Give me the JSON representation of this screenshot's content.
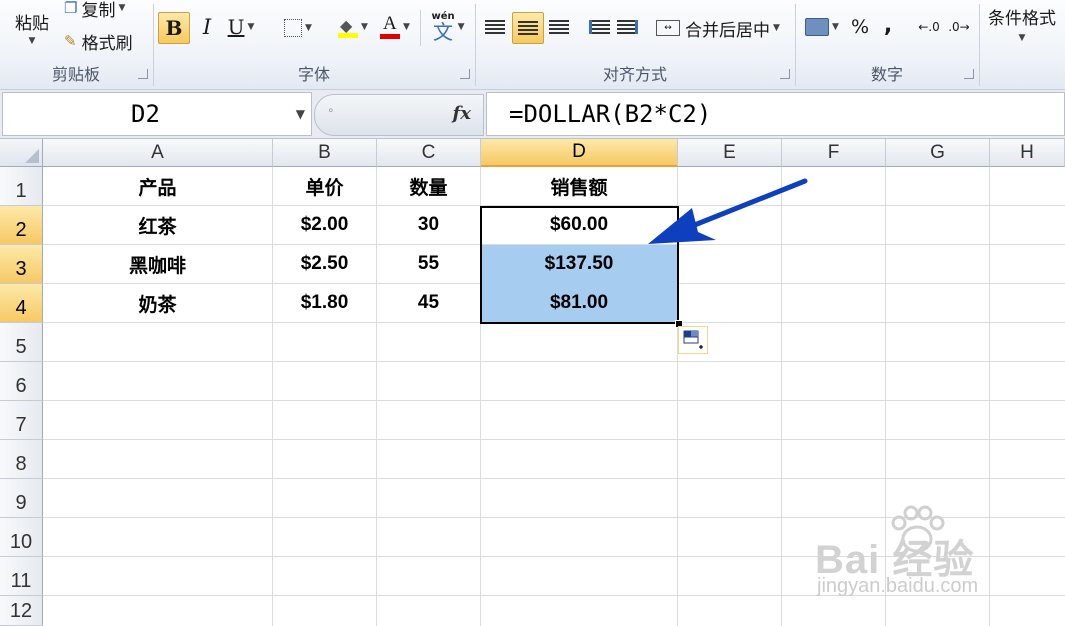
{
  "ribbon": {
    "clipboard": {
      "paste": "粘贴",
      "copy": "复制",
      "format_painter": "格式刷",
      "label": "剪贴板"
    },
    "font": {
      "bold": "B",
      "italic": "I",
      "underline": "U",
      "font_color_glyph": "A",
      "phonetic_top": "wén",
      "phonetic_bottom": "文",
      "label": "字体"
    },
    "alignment": {
      "merge_center": "合并后居中",
      "label": "对齐方式"
    },
    "number": {
      "percent": "%",
      "comma": ",",
      "label": "数字"
    },
    "styles": {
      "conditional_format": "条件格式"
    }
  },
  "formula_bar": {
    "name_box": "D2",
    "formula": "=DOLLAR(B2*C2)",
    "fx": "fx"
  },
  "grid": {
    "columns": [
      "A",
      "B",
      "C",
      "D",
      "E",
      "F",
      "G",
      "H"
    ],
    "rows": [
      "1",
      "2",
      "3",
      "4",
      "5",
      "6",
      "7",
      "8",
      "9",
      "10",
      "11",
      "12"
    ],
    "header_row": [
      "产品",
      "单价",
      "数量",
      "销售额"
    ],
    "data": [
      [
        "红茶",
        "$2.00",
        "30",
        "$60.00"
      ],
      [
        "黑咖啡",
        "$2.50",
        "55",
        "$137.50"
      ],
      [
        "奶茶",
        "$1.80",
        "45",
        "$81.00"
      ]
    ]
  },
  "watermark": {
    "main": "Bai  经验",
    "sub": "jingyan.baidu.com"
  },
  "colors": {
    "selection": "#a6cdf0",
    "arrow": "#0d3fbf",
    "active_header": "#f6c964"
  }
}
